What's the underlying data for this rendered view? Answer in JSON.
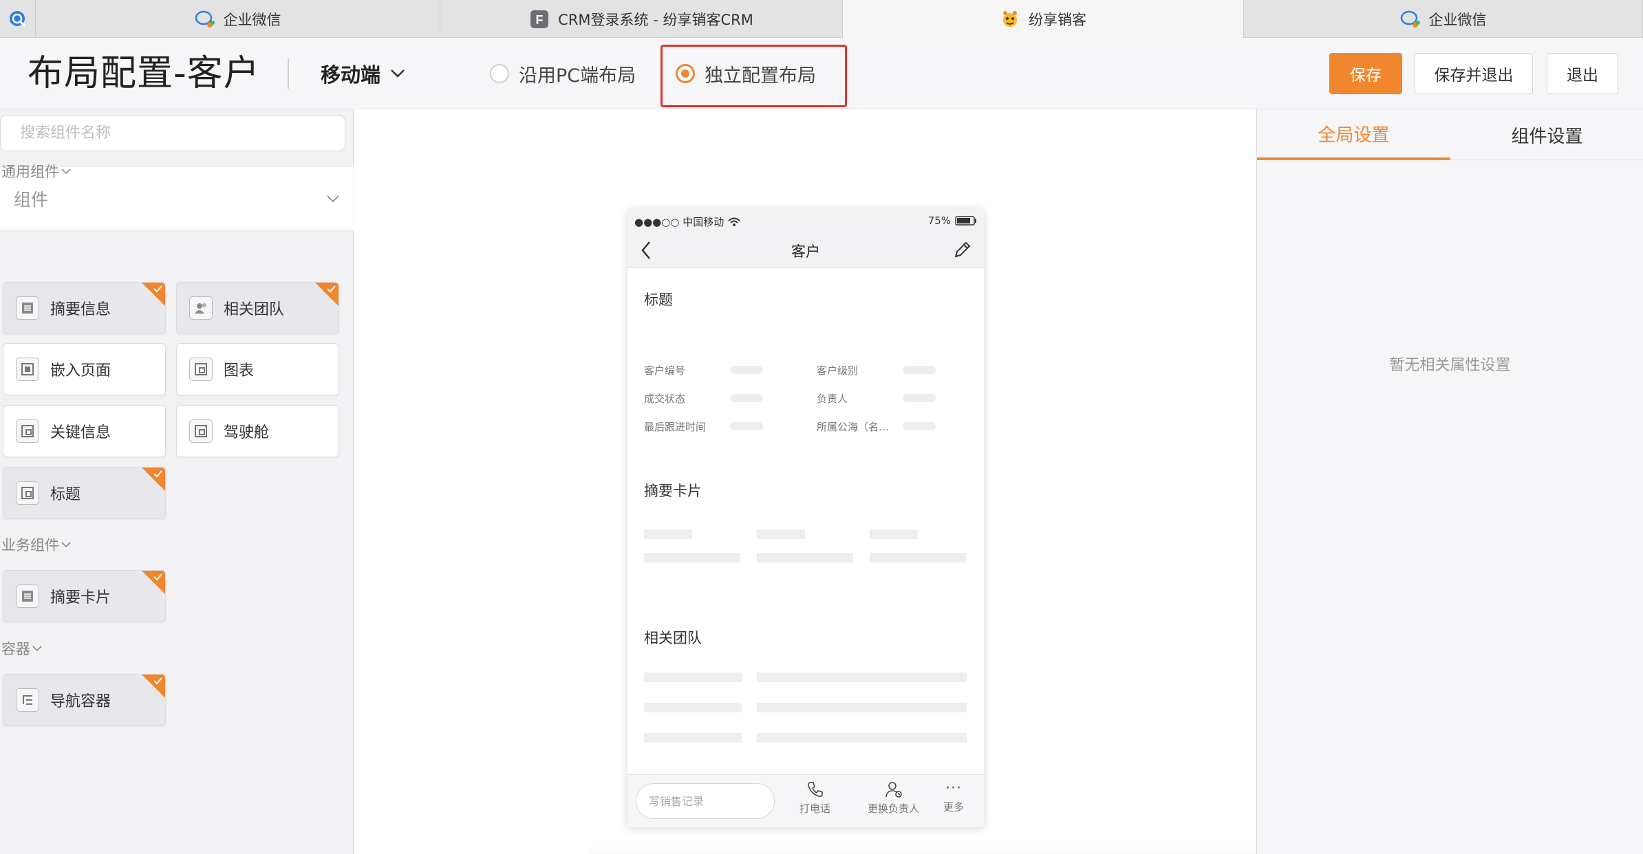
{
  "browser_tabs": [
    {
      "label": "企业微信",
      "icon": "wechat-work-icon"
    },
    {
      "label": "CRM登录系统 - 纷享销客CRM",
      "icon": "f-letter-icon"
    },
    {
      "label": "纷享销客",
      "icon": "fxiaoke-bee-icon"
    },
    {
      "label": "企业微信",
      "icon": "wechat-work-icon"
    }
  ],
  "header": {
    "title": "布局配置-客户",
    "device": "移动端",
    "layout_options": [
      {
        "label": "沿用PC端布局",
        "checked": false
      },
      {
        "label": "独立配置布局",
        "checked": true
      }
    ],
    "buttons": {
      "save": "保存",
      "save_exit": "保存并退出",
      "exit": "退出"
    }
  },
  "left_panel": {
    "search_placeholder": "搜索组件名称",
    "dropdown_label": "组件",
    "sections": [
      {
        "label": "通用组件",
        "items": [
          {
            "label": "摘要信息",
            "icon": "list-icon",
            "used": true
          },
          {
            "label": "相关团队",
            "icon": "team-icon",
            "used": true
          },
          {
            "label": "嵌入页面",
            "icon": "embed-icon",
            "used": false
          },
          {
            "label": "图表",
            "icon": "component-icon",
            "used": false
          },
          {
            "label": "关键信息",
            "icon": "component-icon",
            "used": false
          },
          {
            "label": "驾驶舱",
            "icon": "component-icon",
            "used": false
          },
          {
            "label": "标题",
            "icon": "component-icon",
            "used": true
          }
        ]
      },
      {
        "label": "业务组件",
        "items": [
          {
            "label": "摘要卡片",
            "icon": "list-icon",
            "used": true
          }
        ]
      },
      {
        "label": "容器",
        "items": [
          {
            "label": "导航容器",
            "icon": "nav-container-icon",
            "used": true
          }
        ]
      }
    ]
  },
  "phone": {
    "carrier": "●●●○○ 中国移动",
    "battery": "75%",
    "nav_title": "客户",
    "title_section": "标题",
    "fields": [
      "客户编号",
      "客户级别",
      "成交状态",
      "负责人",
      "最后跟进时间",
      "所属公海（名…"
    ],
    "summary_card": "摘要卡片",
    "related_team": "相关团队",
    "bottom": {
      "input_placeholder": "写销售记录",
      "call": "打电话",
      "change_owner": "更换负责人",
      "more_dots": "···",
      "more": "更多"
    }
  },
  "right_panel": {
    "tabs": [
      {
        "label": "全局设置",
        "active": true
      },
      {
        "label": "组件设置",
        "active": false
      }
    ],
    "empty_text": "暂无相关属性设置"
  },
  "colors": {
    "accent": "#f0862d",
    "highlight": "#e03232"
  }
}
